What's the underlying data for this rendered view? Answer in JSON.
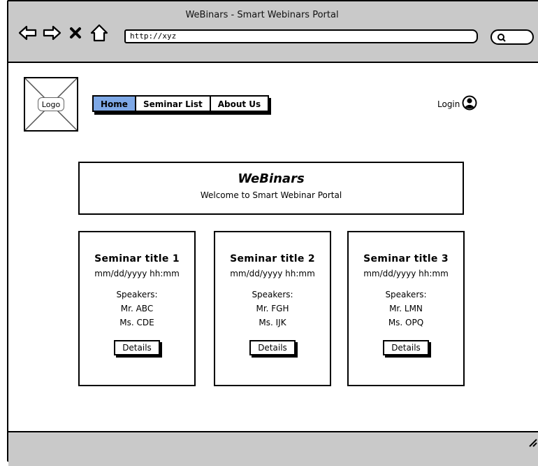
{
  "window": {
    "title": "WeBinars - Smart Webinars Portal"
  },
  "browser": {
    "address": "http://xyz",
    "icons": [
      "back-icon",
      "forward-icon",
      "close-icon",
      "home-icon",
      "search-icon"
    ]
  },
  "header": {
    "logo_label": "Logo",
    "nav": [
      "Home",
      "Seminar List",
      "About Us"
    ],
    "active_nav": "Home",
    "login_label": "Login"
  },
  "hero": {
    "title": "WeBinars",
    "subtitle": "Welcome to Smart Webinar Portal"
  },
  "seminars": [
    {
      "title": "Seminar title 1",
      "date": "mm/dd/yyyy hh:mm",
      "speakers_label": "Speakers:",
      "speakers": [
        "Mr. ABC",
        "Ms. CDE"
      ],
      "details_label": "Details"
    },
    {
      "title": "Seminar title 2",
      "date": "mm/dd/yyyy hh:mm",
      "speakers_label": "Speakers:",
      "speakers": [
        "Mr. FGH",
        "Ms. IJK"
      ],
      "details_label": "Details"
    },
    {
      "title": "Seminar title 3",
      "date": "mm/dd/yyyy hh:mm",
      "speakers_label": "Speakers:",
      "speakers": [
        "Mr. LMN",
        "Ms. OPQ"
      ],
      "details_label": "Details"
    }
  ],
  "colors": {
    "active_tab": "#7ea8e6",
    "chrome": "#c9c9c9"
  }
}
